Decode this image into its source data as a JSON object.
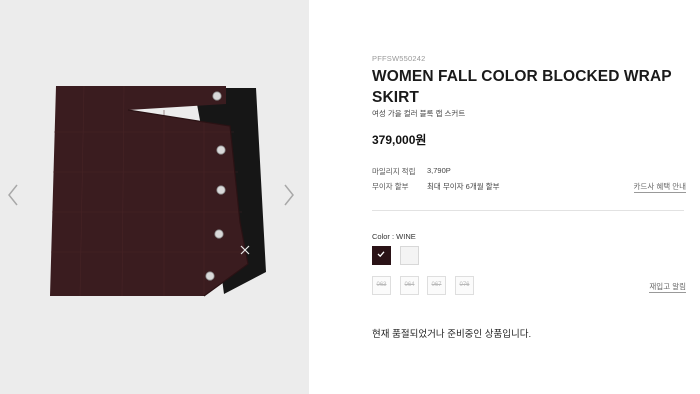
{
  "gallery": {
    "prev_icon": "chevron-left-icon",
    "next_icon": "chevron-right-icon",
    "image_alt": "wine color blocked wrap skirt"
  },
  "product": {
    "sku": "PFFSW550242",
    "title": "WOMEN FALL COLOR BLOCKED WRAP SKIRT",
    "subtitle": "여성 가을 컬러 블록 랩 스커트",
    "price": "379,000원"
  },
  "benefits": {
    "mileage_label": "마일리지 적립",
    "mileage_value": "3,790P",
    "installment_label": "무이자 할부",
    "installment_value": "최대 무이자 6개월 할부",
    "card_benefit_link": "카드사 혜택 안내"
  },
  "options": {
    "color_label": "Color : WINE",
    "colors": [
      {
        "name": "WINE",
        "hex": "#2a1216",
        "selected": true
      },
      {
        "name": "WHITE",
        "hex": "#f4f4f4",
        "selected": false
      }
    ],
    "sizes": [
      "063",
      "064",
      "067",
      "076"
    ],
    "restock_link": "재입고 알림"
  },
  "status": {
    "soldout_message": "현재 품절되었거나 준비중인 상품입니다."
  }
}
